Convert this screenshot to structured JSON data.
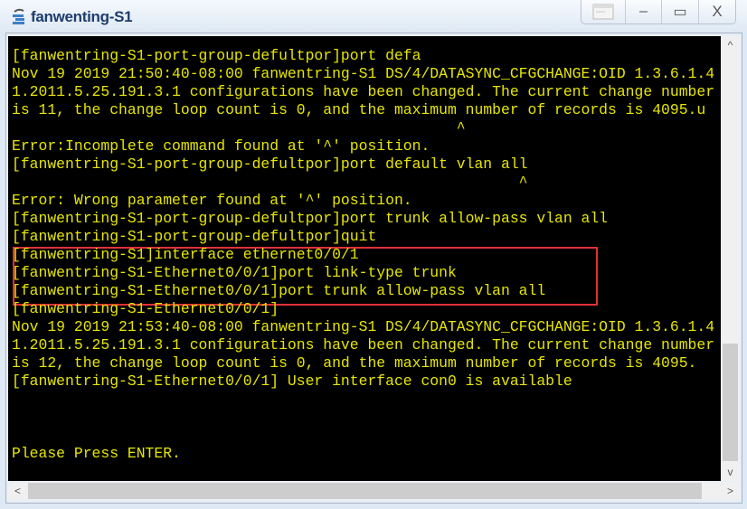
{
  "window": {
    "title": "fanwenting-S1",
    "icon": "terminal-app-icon"
  },
  "controls": {
    "restore_icon": "console-icon",
    "minimize": "–",
    "maximize": "▭",
    "close": "X"
  },
  "terminal": {
    "lines": [
      "[fanwentring-S1-port-group-defultpor]port defa",
      "Nov 19 2019 21:50:40-08:00 fanwentring-S1 DS/4/DATASYNC_CFGCHANGE:OID 1.3.6.1.4",
      "1.2011.5.25.191.3.1 configurations have been changed. The current change number",
      "is 11, the change loop count is 0, and the maximum number of records is 4095.u",
      "                                                  ^",
      "Error:Incomplete command found at '^' position.",
      "[fanwentring-S1-port-group-defultpor]port default vlan all",
      "                                                         ^",
      "Error: Wrong parameter found at '^' position.",
      "[fanwentring-S1-port-group-defultpor]port trunk allow-pass vlan all",
      "[fanwentring-S1-port-group-defultpor]quit",
      "[fanwentring-S1]interface ethernet0/0/1",
      "[fanwentring-S1-Ethernet0/0/1]port link-type trunk",
      "[fanwentring-S1-Ethernet0/0/1]port trunk allow-pass vlan all",
      "[fanwentring-S1-Ethernet0/0/1]",
      "Nov 19 2019 21:53:40-08:00 fanwentring-S1 DS/4/DATASYNC_CFGCHANGE:OID 1.3.6.1.4",
      "1.2011.5.25.191.3.1 configurations have been changed. The current change number",
      "is 12, the change loop count is 0, and the maximum number of records is 4095.",
      "[fanwentring-S1-Ethernet0/0/1] User interface con0 is available",
      "",
      "",
      "",
      "Please Press ENTER."
    ],
    "highlight_color": "#e0303a",
    "text_color": "#e6e600"
  }
}
